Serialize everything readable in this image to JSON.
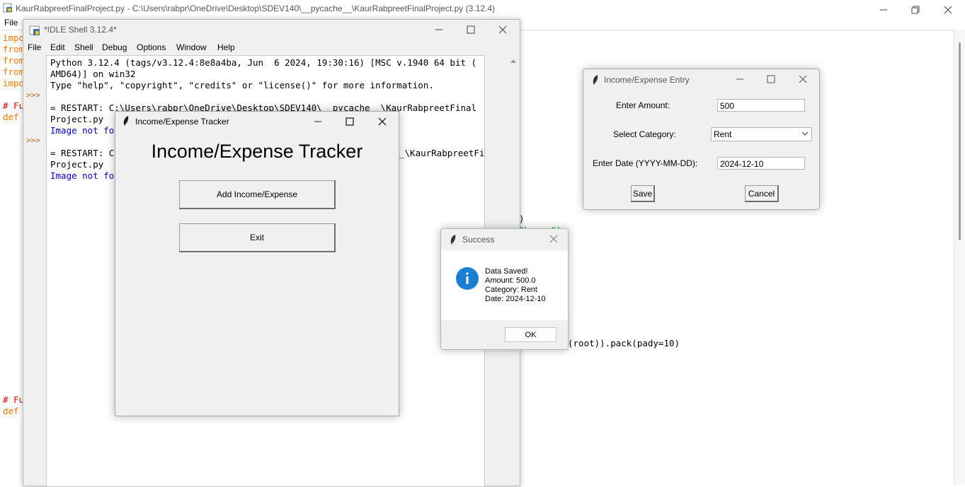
{
  "editor": {
    "title": "KaurRabpreetFinalProject.py - C:\\Users\\rabpr\\OneDrive\\Desktop\\SDEV140\\__pycache__\\KaurRabpreetFinalProject.py (3.12.4)",
    "menu_file": "File",
    "code_left": [
      "impo",
      "from",
      "from",
      "from",
      "impo",
      "",
      "# Fu",
      "def "
    ],
    "code_left_bottom": [
      "# Fu",
      "def "
    ],
    "fragment_paren": ")",
    "fragment_hover": "\"hover\")",
    "fragment_pack": "(root)).pack(pady=10)"
  },
  "shell": {
    "title": "*IDLE Shell 3.12.4*",
    "menu": [
      "File",
      "Edit",
      "Shell",
      "Debug",
      "Options",
      "Window",
      "Help"
    ],
    "prompt": ">>>",
    "lines": [
      "Python 3.12.4 (tags/v3.12.4:8e8a4ba, Jun  6 2024, 19:30:16) [MSC v.1940 64 bit (",
      "AMD64)] on win32",
      "Type \"help\", \"copyright\", \"credits\" or \"license()\" for more information.",
      "",
      "= RESTART: C:\\Users\\rabpr\\OneDrive\\Desktop\\SDEV140\\__pycache__\\KaurRabpreetFinal",
      "Project.py",
      "Image not fo",
      "",
      "= RESTART: C",
      "Project.py",
      "Image not fo"
    ],
    "restart2_tail": "_\\KaurRabpreetFinal"
  },
  "tracker": {
    "window_title": "Income/Expense Tracker",
    "heading": "Income/Expense Tracker",
    "add_button": "Add Income/Expense",
    "exit_button": "Exit"
  },
  "entry": {
    "window_title": "Income/Expense Entry",
    "amount_label": "Enter Amount:",
    "amount_value": "500",
    "category_label": "Select Category:",
    "category_value": "Rent",
    "date_label": "Enter Date (YYYY-MM-DD):",
    "date_value": "2024-12-10",
    "save_button": "Save",
    "cancel_button": "Cancel"
  },
  "success": {
    "window_title": "Success",
    "message": [
      "Data Saved!",
      "Amount: 500.0",
      "Category: Rent",
      "Date: 2024-12-10"
    ],
    "ok_button": "OK"
  }
}
